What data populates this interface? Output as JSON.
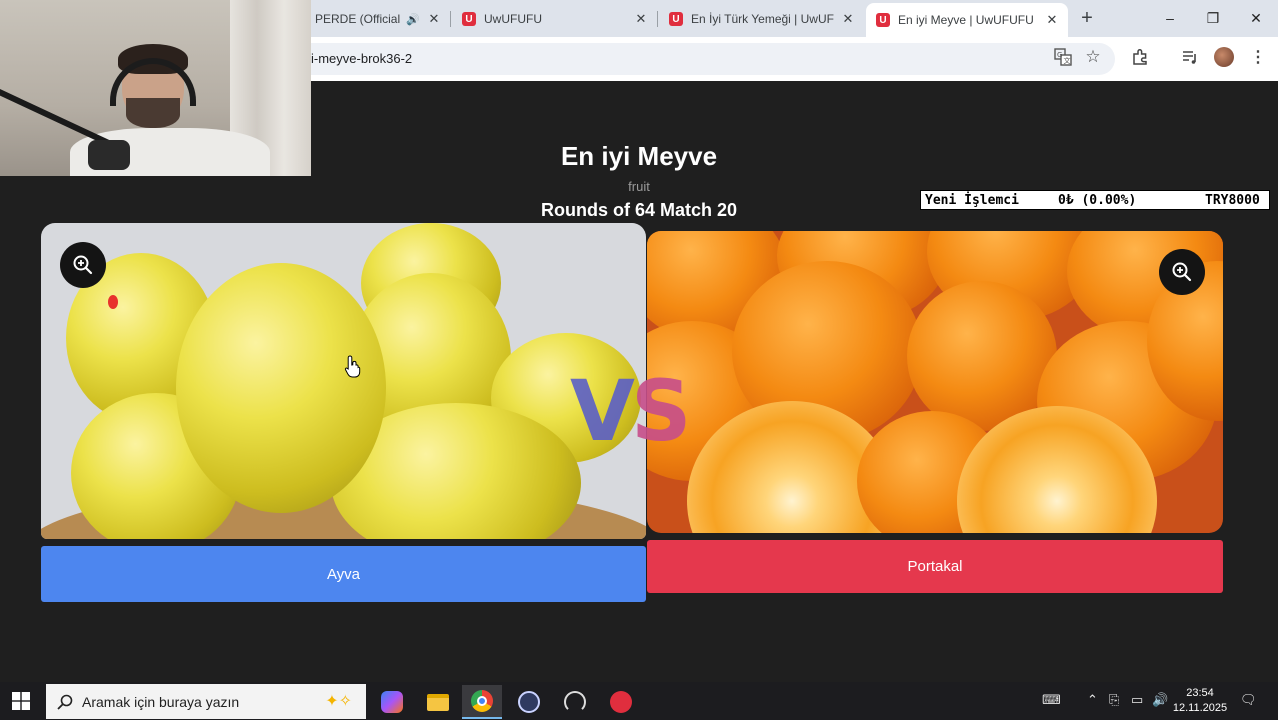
{
  "browser": {
    "tabs": [
      {
        "label": "PERDE (Official V",
        "icon": "youtube-audio-tab",
        "has_speaker": true,
        "active": false
      },
      {
        "label": "UwUFUFU",
        "icon": "uwufufu-favicon",
        "active": false
      },
      {
        "label": "En İyi Türk Yemeği | UwUFUF",
        "icon": "uwufufu-favicon",
        "active": false
      },
      {
        "label": "En iyi Meyve | UwUFUFU",
        "icon": "uwufufu-favicon",
        "active": true
      }
    ],
    "new_tab_symbol": "+",
    "url": "i-meyve-brok36-2",
    "window_controls": {
      "minimize": "–",
      "maximize": "❐",
      "close": "✕"
    }
  },
  "page": {
    "title": "En iyi Meyve",
    "category": "fruit",
    "round_info": "Rounds of 64 Match 20",
    "vs_text": {
      "v": "V",
      "s": "S"
    },
    "left_choice": {
      "label": "Ayva",
      "image": "quince-fruits-photo",
      "button_color": "#4d86ef"
    },
    "right_choice": {
      "label": "Portakal",
      "image": "oranges-photo",
      "button_color": "#e5384d"
    }
  },
  "ticker": {
    "name": "Yeni İşlemci",
    "change": "0₺ (0.00%)",
    "price": "TRY8000"
  },
  "taskbar": {
    "search_placeholder": "Aramak için buraya yazın",
    "apps": [
      "copilot-icon",
      "file-explorer-icon",
      "chrome-icon",
      "obs-icon",
      "speedtest-icon",
      "app-icon"
    ],
    "clock_time": "23:54",
    "clock_date": "12.11.2025"
  }
}
